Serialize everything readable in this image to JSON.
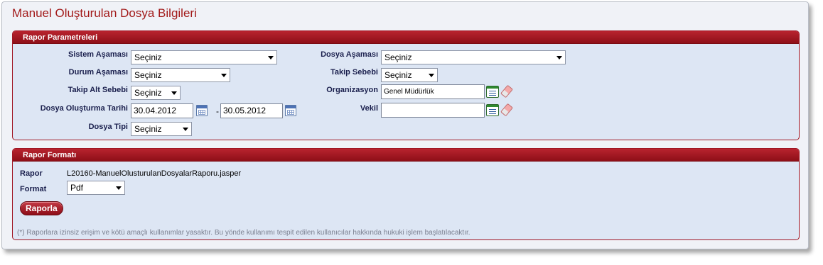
{
  "page_title": "Manuel Oluşturulan Dosya Bilgileri",
  "params_panel": {
    "title": "Rapor Parametreleri",
    "sistem_asamasi": {
      "label": "Sistem Aşaması",
      "value": "Seçiniz"
    },
    "dosya_asamasi": {
      "label": "Dosya Aşaması",
      "value": "Seçiniz"
    },
    "durum_asamasi": {
      "label": "Durum Aşaması",
      "value": "Seçiniz"
    },
    "takip_sebebi": {
      "label": "Takip Sebebi",
      "value": "Seçiniz"
    },
    "takip_alt_sebebi": {
      "label": "Takip Alt Sebebi",
      "value": "Seçiniz"
    },
    "organizasyon": {
      "label": "Organizasyon",
      "value": "Genel Müdürlük"
    },
    "dosya_olusturma_tarihi": {
      "label": "Dosya Oluşturma Tarihi",
      "start": "30.04.2012",
      "separator": "-",
      "end": "30.05.2012"
    },
    "vekil": {
      "label": "Vekil",
      "value": ""
    },
    "dosya_tipi": {
      "label": "Dosya Tipi",
      "value": "Seçiniz"
    }
  },
  "format_panel": {
    "title": "Rapor Formatı",
    "rapor": {
      "label": "Rapor",
      "value": "L20160-ManuelOlusturulanDosyalarRaporu.jasper"
    },
    "format": {
      "label": "Format",
      "value": "Pdf"
    },
    "button_label": "Raporla",
    "note": "(*) Raporlara izinsiz erişim ve kötü amaçlı kullanımlar yasaktır. Bu yönde kullanımı tespit edilen kullanıcılar hakkında hukuki işlem başlatılacaktır."
  },
  "icons": {
    "calendar": "calendar-icon",
    "list": "list-picker-icon",
    "eraser": "eraser-icon"
  },
  "colors": {
    "accent": "#a21a1a",
    "panel_header": "#8e0f18",
    "panel_body": "#dde6f4"
  }
}
